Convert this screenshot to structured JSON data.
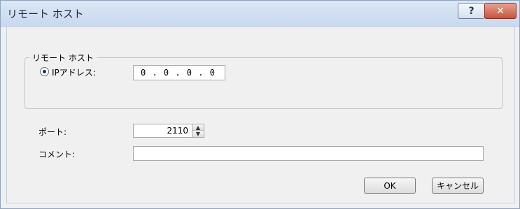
{
  "window": {
    "title": "リモート ホスト",
    "help_label": "?",
    "close_label": "✕"
  },
  "group": {
    "legend": "リモート ホスト",
    "ip_radio_label": "IPアドレス:",
    "ip_value": "0 . 0 . 0 . 0"
  },
  "port": {
    "label": "ポート:",
    "value": "2110",
    "up_glyph": "▲",
    "down_glyph": "▼"
  },
  "comment": {
    "label": "コメント:",
    "value": ""
  },
  "buttons": {
    "ok": "OK",
    "cancel": "キャンセル"
  }
}
